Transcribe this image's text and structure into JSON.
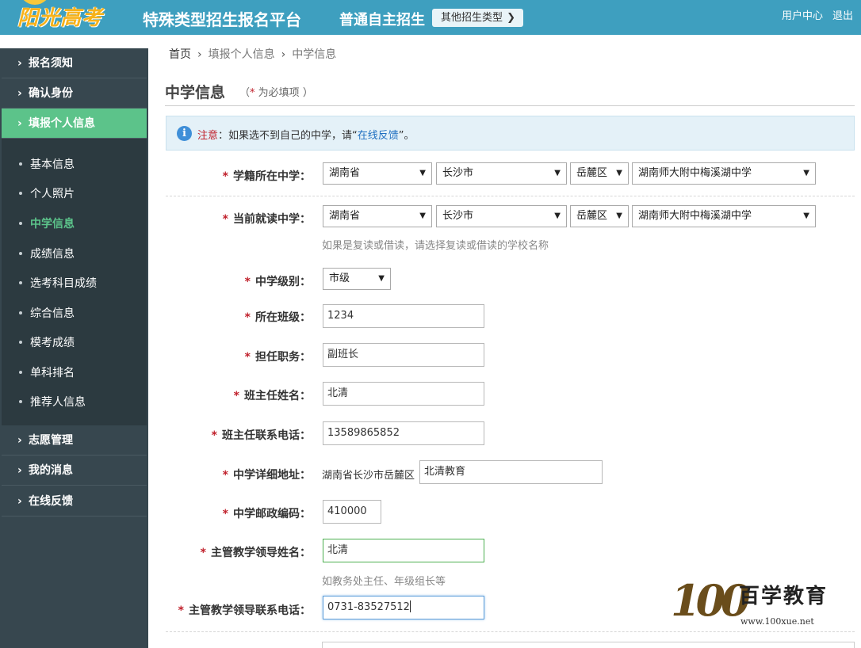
{
  "header": {
    "logo": "阳光高考",
    "platform_title": "特殊类型招生报名平台",
    "type_title": "普通自主招生",
    "other_types_button": "其他招生类型",
    "user_center": "用户中心",
    "logout": "退出"
  },
  "sidebar": {
    "items": [
      {
        "label": "报名须知"
      },
      {
        "label": "确认身份"
      },
      {
        "label": "填报个人信息"
      },
      {
        "label": "志愿管理"
      },
      {
        "label": "我的消息"
      },
      {
        "label": "在线反馈"
      }
    ],
    "sub_items": [
      {
        "label": "基本信息"
      },
      {
        "label": "个人照片"
      },
      {
        "label": "中学信息"
      },
      {
        "label": "成绩信息"
      },
      {
        "label": "选考科目成绩"
      },
      {
        "label": "综合信息"
      },
      {
        "label": "模考成绩"
      },
      {
        "label": "单科排名"
      },
      {
        "label": "推荐人信息"
      }
    ]
  },
  "breadcrumb": {
    "home": "首页",
    "step": "填报个人信息",
    "current": "中学信息"
  },
  "page": {
    "title": "中学信息",
    "required_note_open": "（",
    "required_star": "*",
    "required_note": "为必填项",
    "required_note_close": "）"
  },
  "notice": {
    "label": "注意",
    "text_before": "：如果选不到自己的中学，请“",
    "link": "在线反馈",
    "text_after": "”。"
  },
  "form": {
    "star": "*",
    "registry_school_label": "学籍所在中学：",
    "registry_province": "湖南省",
    "registry_city": "长沙市",
    "registry_district": "岳麓区",
    "registry_school": "湖南师大附中梅溪湖中学",
    "current_school_label": "当前就读中学：",
    "current_province": "湖南省",
    "current_city": "长沙市",
    "current_district": "岳麓区",
    "current_school": "湖南师大附中梅溪湖中学",
    "current_school_hint": "如果是复读或借读，请选择复读或借读的学校名称",
    "school_level_label": "中学级别：",
    "school_level": "市级",
    "class_label": "所在班级：",
    "class_value": "1234",
    "position_label": "担任职务：",
    "position_value": "副班长",
    "teacher_name_label": "班主任姓名：",
    "teacher_name_value": "北清",
    "teacher_phone_label": "班主任联系电话：",
    "teacher_phone_value": "13589865852",
    "address_label": "中学详细地址：",
    "address_prefix": "湖南省长沙市岳麓区",
    "address_value": "北清教育",
    "postcode_label": "中学邮政编码：",
    "postcode_value": "410000",
    "leader_name_label": "主管教学领导姓名：",
    "leader_name_value": "北清",
    "leader_name_hint": "如教务处主任、年级组长等",
    "leader_phone_label": "主管教学领导联系电话：",
    "leader_phone_value": "0731-83527512"
  },
  "watermark": {
    "number": "100",
    "text": "百学教育",
    "url": "www.100xue.net"
  },
  "colors": {
    "header_bg": "#3e9fbf",
    "sidebar_bg": "#37474f",
    "sidebar_active": "#5cc38a",
    "required_star": "#c0202b",
    "link": "#1f6fc0"
  }
}
